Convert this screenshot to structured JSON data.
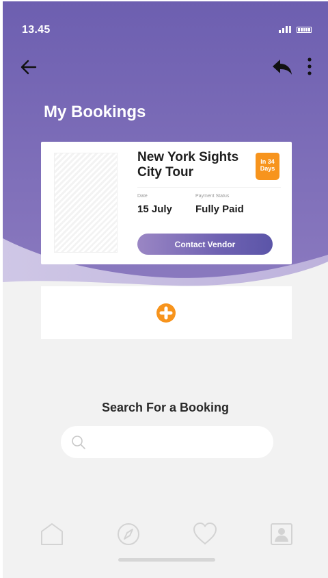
{
  "status_bar": {
    "time": "13.45"
  },
  "header": {
    "title": "My Bookings"
  },
  "booking": {
    "title": "New York Sights City Tour",
    "badge": {
      "line1": "In 34",
      "line2": "Days"
    },
    "date_label": "Date",
    "date_value": "15 July",
    "payment_label": "Payment Status",
    "payment_value": "Fully Paid",
    "contact_label": "Contact Vendor"
  },
  "search": {
    "title": "Search For a Booking",
    "placeholder": ""
  },
  "icons": {
    "back": "arrow-left-icon",
    "reply": "reply-icon",
    "more": "more-vertical-icon",
    "add": "plus-circle-icon",
    "search": "search-icon",
    "nav": [
      "home-icon",
      "compass-icon",
      "heart-icon",
      "profile-icon"
    ]
  },
  "colors": {
    "accent": "#f7941d",
    "primary": "#7b6bb6",
    "background": "#f2f2f2"
  }
}
